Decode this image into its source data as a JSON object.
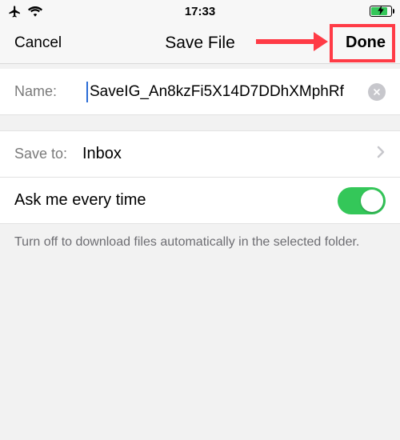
{
  "status": {
    "time": "17:33"
  },
  "nav": {
    "cancel": "Cancel",
    "title": "Save File",
    "done": "Done"
  },
  "nameRow": {
    "label": "Name:",
    "value": "SaveIG_An8kzFi5X14D7DDhXMphRf"
  },
  "saveToRow": {
    "label": "Save to:",
    "value": "Inbox"
  },
  "toggleRow": {
    "label": "Ask me every time",
    "on": true
  },
  "footer": "Turn off to download files automatically in the selected folder."
}
